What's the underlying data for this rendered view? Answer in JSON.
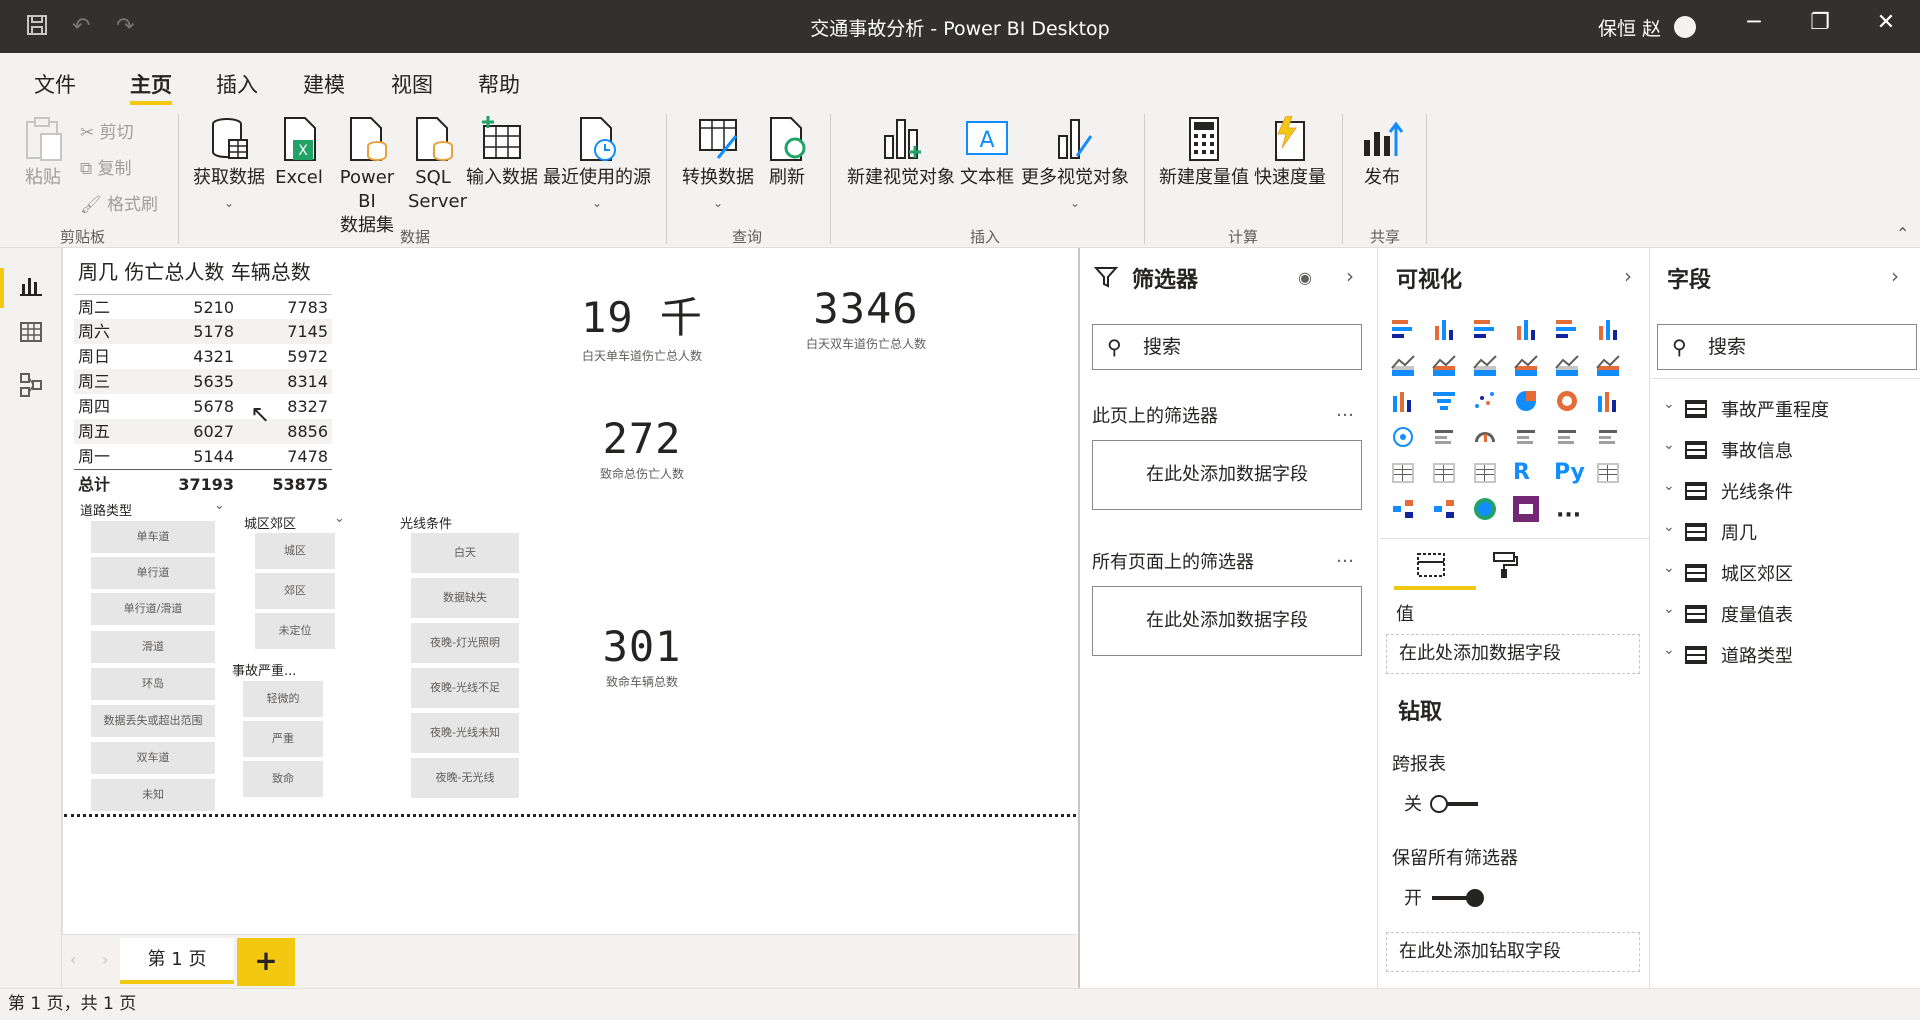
{
  "window": {
    "title": "交通事故分析 - Power BI Desktop",
    "user": "保恒 赵",
    "minimize": "─",
    "restore": "❐",
    "close": "✕"
  },
  "menu": {
    "tabs": [
      "文件",
      "主页",
      "插入",
      "建模",
      "视图",
      "帮助"
    ],
    "active": "主页"
  },
  "ribbon": {
    "paste": "粘贴",
    "cut": "剪切",
    "copy": "复制",
    "format_painter": "格式刷",
    "get_data": "获取数据",
    "excel": "Excel",
    "pbi_datasets_1": "Power BI",
    "pbi_datasets_2": "数据集",
    "sql_1": "SQL",
    "sql_2": "Server",
    "enter_data": "输入数据",
    "recent_sources": "最近使用的源",
    "transform": "转换数据",
    "refresh": "刷新",
    "new_visual": "新建视觉对象",
    "text_box": "文本框",
    "more_visuals": "更多视觉对象",
    "new_measure": "新建度量值",
    "quick_measure": "快速度量",
    "publish": "发布",
    "groups": {
      "clipboard": "剪贴板",
      "data": "数据",
      "query": "查询",
      "insert": "插入",
      "calc": "计算",
      "share": "共享"
    }
  },
  "table_visual": {
    "headers": [
      "周几",
      "伤亡总人数",
      "车辆总数"
    ],
    "rows": [
      [
        "周二",
        "5210",
        "7783"
      ],
      [
        "周六",
        "5178",
        "7145"
      ],
      [
        "周日",
        "4321",
        "5972"
      ],
      [
        "周三",
        "5635",
        "8314"
      ],
      [
        "周四",
        "5678",
        "8327"
      ],
      [
        "周五",
        "6027",
        "8856"
      ],
      [
        "周一",
        "5144",
        "7478"
      ]
    ],
    "total": [
      "总计",
      "37193",
      "53875"
    ]
  },
  "slicers": {
    "road_type": {
      "title": "道路类型",
      "items": [
        "单车道",
        "单行道",
        "单行道/滑道",
        "滑道",
        "环岛",
        "数据丢失或超出范围",
        "双车道",
        "未知"
      ]
    },
    "urban_rural": {
      "title": "城区郊区",
      "items": [
        "城区",
        "郊区",
        "未定位"
      ]
    },
    "severity": {
      "title": "事故严重...",
      "items": [
        "轻微的",
        "严重",
        "致命"
      ]
    },
    "light": {
      "title": "光线条件",
      "items": [
        "白天",
        "数据缺失",
        "夜晚-灯光照明",
        "夜晚-光线不足",
        "夜晚-光线未知",
        "夜晚-无光线"
      ]
    }
  },
  "cards": [
    {
      "value": "19 千",
      "caption": "白天单车道伤亡总人数"
    },
    {
      "value": "3346",
      "caption": "白天双车道伤亡总人数"
    },
    {
      "value": "272",
      "caption": "致命总伤亡人数"
    },
    {
      "value": "301",
      "caption": "致命车辆总数"
    }
  ],
  "pages": {
    "tab": "第 1 页",
    "add": "+",
    "status": "第 1 页，共 1 页"
  },
  "filters_pane": {
    "title": "筛选器",
    "search": "搜索",
    "this_page": "此页上的筛选器",
    "all_pages": "所有页面上的筛选器",
    "add_field": "在此处添加数据字段",
    "more": "…"
  },
  "viz_pane": {
    "title": "可视化",
    "values_label": "值",
    "add_field": "在此处添加数据字段",
    "drill_title": "钻取",
    "cross_report": "跨报表",
    "off": "关",
    "keep_filters": "保留所有筛选器",
    "on": "开",
    "add_drill": "在此处添加钻取字段",
    "more": "···",
    "r_icon": "R",
    "py_icon": "Py"
  },
  "fields_pane": {
    "title": "字段",
    "search": "搜索",
    "tables": [
      "事故严重程度",
      "事故信息",
      "光线条件",
      "周几",
      "城区郊区",
      "度量值表",
      "道路类型"
    ]
  },
  "colors": {
    "accent": "#f2c811",
    "titlebar": "#323130",
    "chrome": "#f3f2f1",
    "bar_blue": "#118dff",
    "bar_navy": "#12239e",
    "bar_orange": "#e66c37"
  }
}
